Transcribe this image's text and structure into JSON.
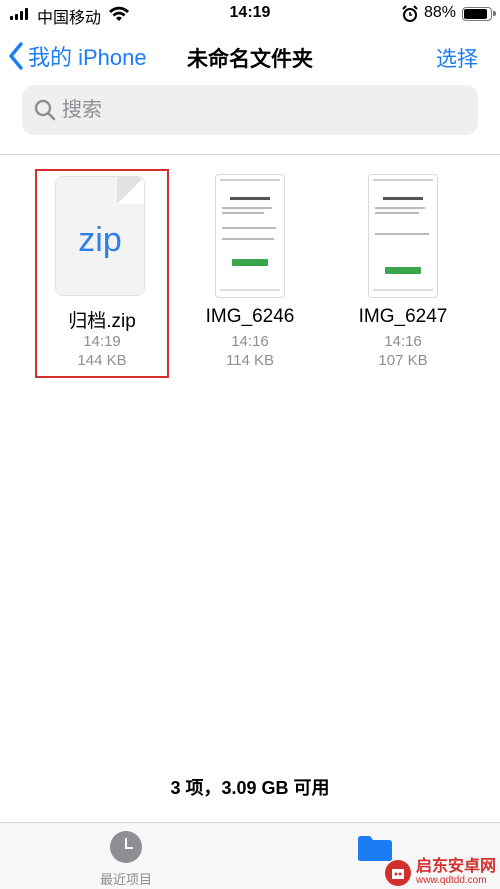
{
  "status_bar": {
    "carrier": "中国移动",
    "time": "14:19",
    "battery_percent": "88%",
    "battery_level": 0.88
  },
  "nav": {
    "back_label": "我的 iPhone",
    "title": "未命名文件夹",
    "select_label": "选择"
  },
  "search": {
    "placeholder": "搜索"
  },
  "files": [
    {
      "name": "归档.zip",
      "time": "14:19",
      "size": "144 KB",
      "icon": "zip-file-icon",
      "icon_text": "zip"
    },
    {
      "name": "IMG_6246",
      "time": "14:16",
      "size": "114 KB",
      "icon": "image-thumbnail"
    },
    {
      "name": "IMG_6247",
      "time": "14:16",
      "size": "107 KB",
      "icon": "image-thumbnail"
    }
  ],
  "footer": {
    "summary": "3 项，3.09 GB 可用"
  },
  "tab_bar": {
    "recent_label": "最近项目"
  },
  "watermark": {
    "name": "启东安卓网",
    "url": "www.qdtdd.com"
  },
  "colors": {
    "accent": "#1a7df5",
    "highlight_border": "#d32f2f"
  }
}
